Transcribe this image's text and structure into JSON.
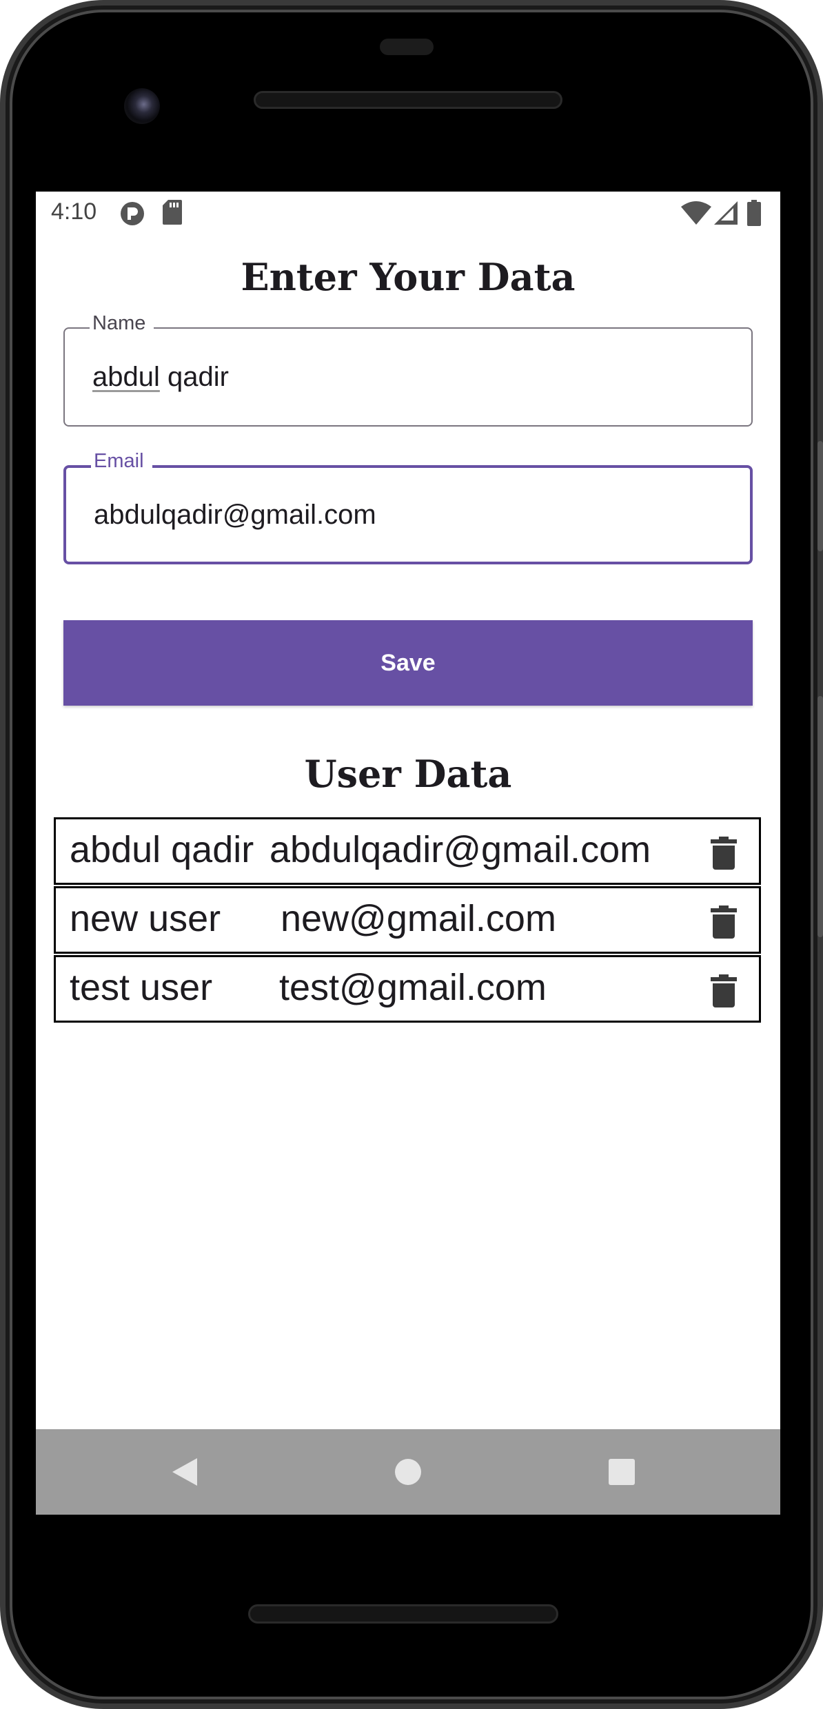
{
  "status_bar": {
    "time": "4:10",
    "left_icons": [
      "notification-p-icon",
      "sd-card-icon"
    ],
    "right_icons": [
      "wifi-icon",
      "signal-icon",
      "battery-icon"
    ]
  },
  "header": {
    "title": "Enter Your Data"
  },
  "form": {
    "name": {
      "label": "Name",
      "value_word1": "abdul",
      "value_rest": " qadir"
    },
    "email": {
      "label": "Email",
      "value": "abdulqadir@gmail.com"
    },
    "save_label": "Save"
  },
  "user_data": {
    "title": "User Data",
    "rows": [
      {
        "name": "abdul qadir",
        "email": "abdulqadir@gmail.com",
        "action_icon": "trash-icon"
      },
      {
        "name": "new user",
        "email": "new@gmail.com",
        "action_icon": "trash-icon"
      },
      {
        "name": "test user",
        "email": "test@gmail.com",
        "action_icon": "trash-icon"
      }
    ]
  },
  "nav_bar": {
    "buttons": [
      "back-icon",
      "home-icon",
      "recents-icon"
    ]
  },
  "colors": {
    "accent": "#6750a4",
    "nav_bar": "#9c9c9c",
    "text": "#1d1b20"
  }
}
